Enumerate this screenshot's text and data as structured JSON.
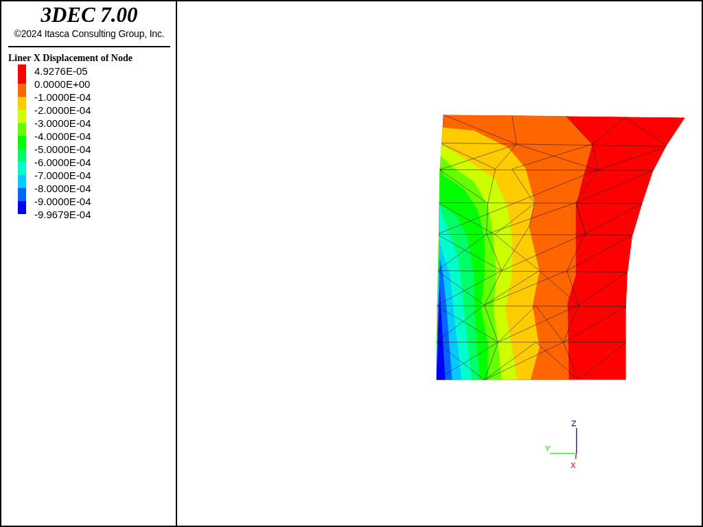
{
  "header": {
    "title": "3DEC 7.00",
    "copyright": "©2024 Itasca Consulting Group, Inc."
  },
  "legend": {
    "title": "Liner X Displacement of Node",
    "labels": [
      "4.9276E-05",
      "0.0000E+00",
      "-1.0000E-04",
      "-2.0000E-04",
      "-3.0000E-04",
      "-4.0000E-04",
      "-5.0000E-04",
      "-6.0000E-04",
      "-7.0000E-04",
      "-8.0000E-04",
      "-9.0000E-04",
      "-9.9679E-04"
    ],
    "bands": [
      {
        "color": "#ff0000"
      },
      {
        "color": "#ff6600"
      },
      {
        "color": "#ffcc00"
      },
      {
        "color": "#ccff00"
      },
      {
        "color": "#66ff00"
      },
      {
        "color": "#00ff00"
      },
      {
        "color": "#00ff66"
      },
      {
        "color": "#00ffcc"
      },
      {
        "color": "#00ccff"
      },
      {
        "color": "#0066ff"
      },
      {
        "color": "#0000ff"
      }
    ]
  },
  "axes": {
    "z": "Z",
    "y": "Y",
    "x": "X"
  }
}
